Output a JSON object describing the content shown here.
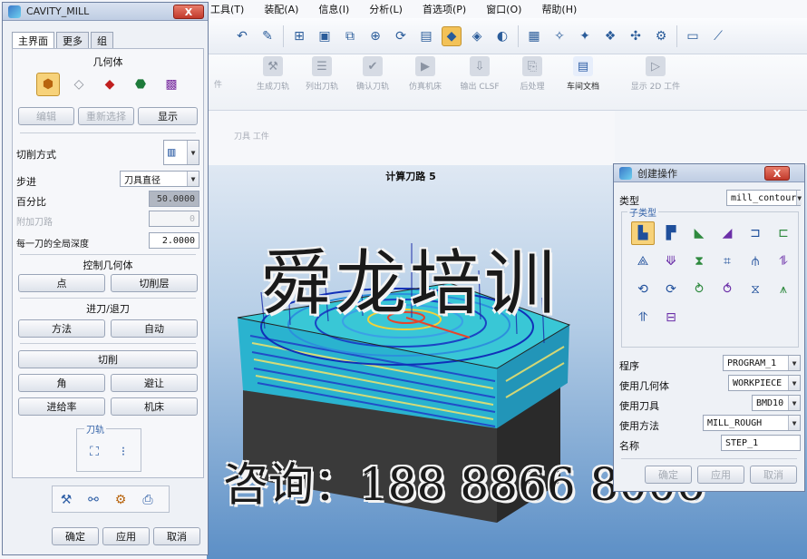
{
  "menubar": {
    "items": [
      "工具(T)",
      "装配(A)",
      "信息(I)",
      "分析(L)",
      "首选项(P)",
      "窗口(O)",
      "帮助(H)"
    ]
  },
  "ribbon": {
    "left_stub": "件",
    "buttons": [
      {
        "label": "生成刀轨",
        "active": false
      },
      {
        "label": "列出刀轨",
        "active": false
      },
      {
        "label": "确认刀轨",
        "active": false
      },
      {
        "label": "仿真机床",
        "active": false
      },
      {
        "label": "输出 CLSF",
        "active": false
      },
      {
        "label": "后处理",
        "active": false
      },
      {
        "label": "车间文档",
        "active": true
      },
      {
        "label": "显示 2D 工件",
        "active": false
      }
    ],
    "secondary_stub": "刀具 工件"
  },
  "viewport": {
    "title": "计算刀路 5"
  },
  "watermark": {
    "title": "舜龙培训",
    "contact": "咨询：188 8866 8006"
  },
  "cavity_dialog": {
    "title": "CAVITY_MILL",
    "close_label": "X",
    "tabs": [
      "主界面",
      "更多",
      "组"
    ],
    "geometry": {
      "heading": "几何体",
      "buttons": [
        "编辑",
        "重新选择",
        "显示"
      ]
    },
    "cut_pattern_label": "切削方式",
    "stepover": {
      "label": "步进",
      "value": "刀具直径"
    },
    "percent": {
      "label": "百分比",
      "value": "50.0000"
    },
    "additional_passes": {
      "label": "附加刀路",
      "value": "0"
    },
    "depth_per_cut": {
      "label": "每一刀的全局深度",
      "value": "2.0000"
    },
    "control_geometry": {
      "heading": "控制几何体",
      "buttons": [
        "点",
        "切削层"
      ]
    },
    "engage_retract": {
      "heading": "进刀/退刀",
      "buttons": [
        "方法",
        "自动"
      ]
    },
    "cutting": {
      "button": "切削",
      "buttons": [
        "角",
        "避让",
        "进给率",
        "机床"
      ]
    },
    "toolpath": {
      "heading": "刀轨"
    },
    "footer": [
      "确定",
      "应用",
      "取消"
    ]
  },
  "create_operation_dialog": {
    "title": "创建操作",
    "close_label": "X",
    "type": {
      "label": "类型",
      "value": "mill_contour"
    },
    "subtype_heading": "子类型",
    "subtype_count": 20,
    "program": {
      "label": "程序",
      "value": "PROGRAM_1"
    },
    "geometry": {
      "label": "使用几何体",
      "value": "WORKPIECE"
    },
    "tool": {
      "label": "使用刀具",
      "value": "BMD10"
    },
    "method": {
      "label": "使用方法",
      "value": "MILL_ROUGH"
    },
    "name": {
      "label": "名称",
      "value": "STEP_1"
    },
    "footer": [
      "确定",
      "应用",
      "取消"
    ]
  }
}
